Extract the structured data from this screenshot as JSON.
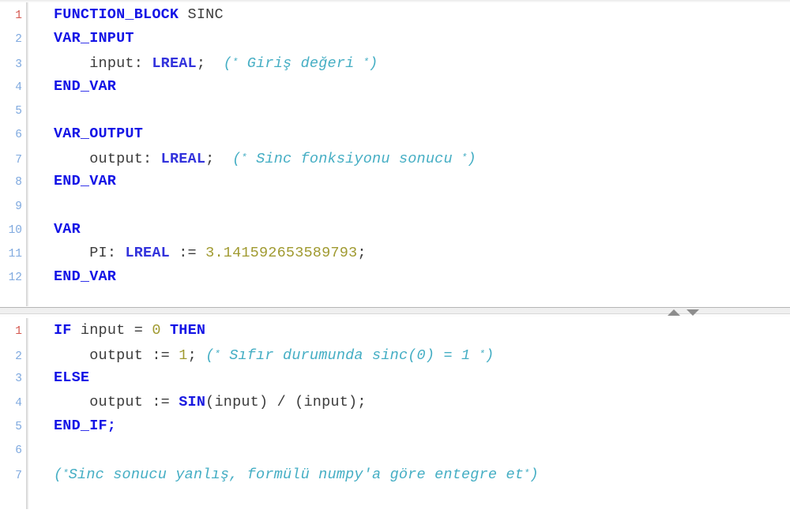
{
  "editor": {
    "language": "IEC 61131-3 Structured Text",
    "splitter": {
      "scroll_up_icon": "triangle-up-icon",
      "scroll_down_icon": "triangle-down-icon"
    }
  },
  "declaration_pane": {
    "name": "declaration-editor",
    "line_numbers": [
      "1",
      "2",
      "3",
      "4",
      "5",
      "6",
      "7",
      "8",
      "9",
      "10",
      "11",
      "12"
    ],
    "lines": [
      {
        "n": "1",
        "tokens": [
          {
            "t": "kw",
            "v": "FUNCTION_BLOCK"
          },
          {
            "t": "op",
            "v": " "
          },
          {
            "t": "id",
            "v": "SINC"
          }
        ]
      },
      {
        "n": "2",
        "tokens": [
          {
            "t": "kw",
            "v": "VAR_INPUT"
          }
        ]
      },
      {
        "n": "3",
        "tokens": [
          {
            "t": "op",
            "v": "    "
          },
          {
            "t": "id",
            "v": "input:"
          },
          {
            "t": "op",
            "v": " "
          },
          {
            "t": "ty",
            "v": "LREAL"
          },
          {
            "t": "op",
            "v": ";"
          },
          {
            "t": "op",
            "v": "  "
          },
          {
            "t": "cmt",
            "v": "(* Giriş değeri *)"
          }
        ]
      },
      {
        "n": "4",
        "tokens": [
          {
            "t": "kw",
            "v": "END_VAR"
          }
        ]
      },
      {
        "n": "5",
        "tokens": []
      },
      {
        "n": "6",
        "tokens": [
          {
            "t": "kw",
            "v": "VAR_OUTPUT"
          }
        ]
      },
      {
        "n": "7",
        "tokens": [
          {
            "t": "op",
            "v": "    "
          },
          {
            "t": "id",
            "v": "output:"
          },
          {
            "t": "op",
            "v": " "
          },
          {
            "t": "ty",
            "v": "LREAL"
          },
          {
            "t": "op",
            "v": ";"
          },
          {
            "t": "op",
            "v": "  "
          },
          {
            "t": "cmt",
            "v": "(* Sinc fonksiyonu sonucu *)"
          }
        ]
      },
      {
        "n": "8",
        "tokens": [
          {
            "t": "kw",
            "v": "END_VAR"
          }
        ]
      },
      {
        "n": "9",
        "tokens": []
      },
      {
        "n": "10",
        "tokens": [
          {
            "t": "kw",
            "v": "VAR"
          }
        ]
      },
      {
        "n": "11",
        "tokens": [
          {
            "t": "op",
            "v": "    "
          },
          {
            "t": "id",
            "v": "PI:"
          },
          {
            "t": "op",
            "v": " "
          },
          {
            "t": "ty",
            "v": "LREAL"
          },
          {
            "t": "op",
            "v": " := "
          },
          {
            "t": "num",
            "v": "3.141592653589793"
          },
          {
            "t": "op",
            "v": ";"
          }
        ]
      },
      {
        "n": "12",
        "tokens": [
          {
            "t": "kw",
            "v": "END_VAR"
          }
        ]
      }
    ]
  },
  "implementation_pane": {
    "name": "implementation-editor",
    "line_numbers": [
      "1",
      "2",
      "3",
      "4",
      "5",
      "6",
      "7"
    ],
    "lines": [
      {
        "n": "1",
        "tokens": [
          {
            "t": "kw",
            "v": "IF"
          },
          {
            "t": "op",
            "v": " "
          },
          {
            "t": "id",
            "v": "input"
          },
          {
            "t": "op",
            "v": " = "
          },
          {
            "t": "num",
            "v": "0"
          },
          {
            "t": "op",
            "v": " "
          },
          {
            "t": "kw",
            "v": "THEN"
          }
        ]
      },
      {
        "n": "2",
        "tokens": [
          {
            "t": "op",
            "v": "    "
          },
          {
            "t": "id",
            "v": "output"
          },
          {
            "t": "op",
            "v": " := "
          },
          {
            "t": "num",
            "v": "1"
          },
          {
            "t": "op",
            "v": ";"
          },
          {
            "t": "op",
            "v": " "
          },
          {
            "t": "cmt",
            "v": "(* Sıfır durumunda sinc(0) = 1 *)"
          }
        ]
      },
      {
        "n": "3",
        "tokens": [
          {
            "t": "kw",
            "v": "ELSE"
          }
        ]
      },
      {
        "n": "4",
        "tokens": [
          {
            "t": "op",
            "v": "    "
          },
          {
            "t": "id",
            "v": "output"
          },
          {
            "t": "op",
            "v": " := "
          },
          {
            "t": "fn",
            "v": "SIN"
          },
          {
            "t": "op",
            "v": "("
          },
          {
            "t": "id",
            "v": "input"
          },
          {
            "t": "op",
            "v": ") / ("
          },
          {
            "t": "id",
            "v": "input"
          },
          {
            "t": "op",
            "v": ");"
          }
        ]
      },
      {
        "n": "5",
        "tokens": [
          {
            "t": "kw",
            "v": "END_IF;"
          }
        ]
      },
      {
        "n": "6",
        "tokens": []
      },
      {
        "n": "7",
        "tokens": [
          {
            "t": "cmt",
            "v": "(*Sinc sonucu yanlış, formülü numpy'a göre entegre et*)"
          }
        ]
      }
    ]
  },
  "colors": {
    "keyword": "#1414e6",
    "function": "#1a1ae0",
    "type": "#3232dc",
    "number": "#a09a30",
    "comment": "#45aec4",
    "identifier": "#3c3c3c",
    "lineno_active": "#d4564e",
    "lineno": "#7fa9df",
    "background": "#ffffff",
    "splitter": "#f0f0f0"
  }
}
